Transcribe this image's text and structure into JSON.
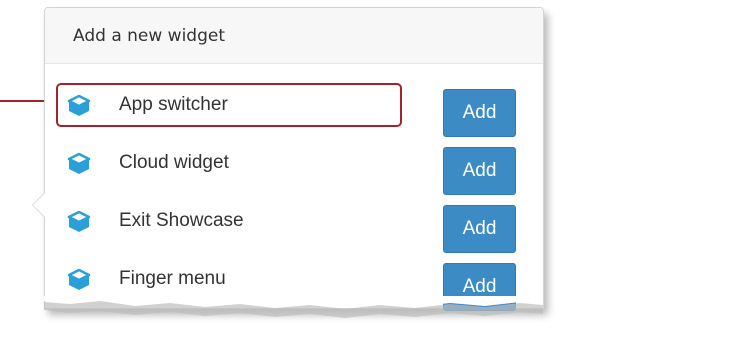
{
  "popover": {
    "title": "Add a new widget"
  },
  "widgets": [
    {
      "label": "App switcher",
      "button": "Add",
      "icon": "cube-icon",
      "highlighted": true
    },
    {
      "label": "Cloud widget",
      "button": "Add",
      "icon": "cube-icon",
      "highlighted": false
    },
    {
      "label": "Exit Showcase",
      "button": "Add",
      "icon": "cube-icon",
      "highlighted": false
    },
    {
      "label": "Finger menu",
      "button": "Add",
      "icon": "cube-icon",
      "highlighted": false
    }
  ],
  "colors": {
    "accent": "#3d8bc4",
    "icon": "#2a9fd8",
    "highlight": "#a3232a"
  }
}
